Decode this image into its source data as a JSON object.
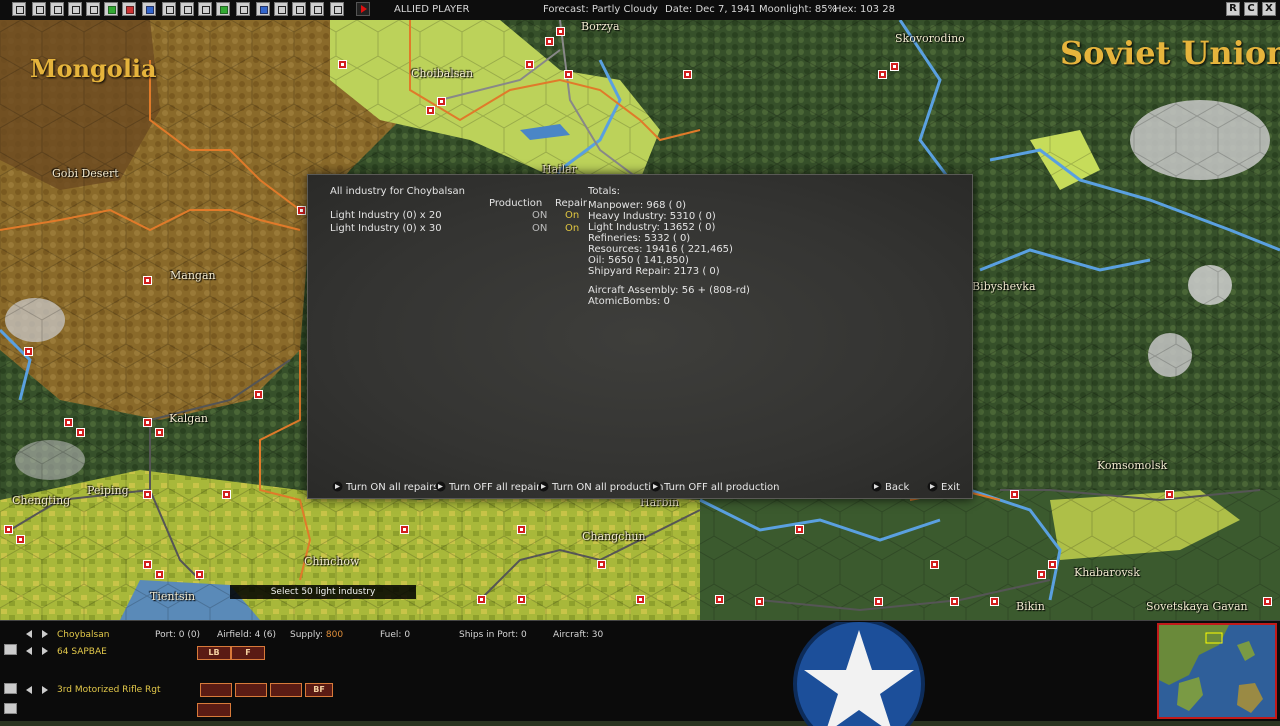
{
  "topbar": {
    "player": "ALLIED PLAYER",
    "forecast": "Forecast: Partly Cloudy",
    "date": "Date: Dec 7, 1941",
    "moonlight": "Moonlight: 85%",
    "hex": "Hex: 103 28",
    "window_buttons": [
      "R",
      "C",
      "X"
    ]
  },
  "map": {
    "countries": [
      "Mongolia",
      "Soviet Union"
    ],
    "places": [
      "Borzya",
      "Skovorodino",
      "Choibalsan",
      "Hailar",
      "Gobi Desert",
      "Mangan",
      "Kalgan",
      "Peiping",
      "Chengting",
      "Chinchow",
      "Tientsin",
      "Harbin",
      "Changchun",
      "Komsomolsk",
      "Khabarovsk",
      "Bikin",
      "Sovetskaya Gavan",
      "Bibyshevka"
    ]
  },
  "dialog": {
    "title": "All industry for Choybalsan",
    "col_production": "Production",
    "col_repair": "Repair",
    "rows": [
      {
        "name": "Light Industry  (0) x 20",
        "production": "ON",
        "repair": "On"
      },
      {
        "name": "Light Industry  (0) x 30",
        "production": "ON",
        "repair": "On"
      }
    ],
    "totals_title": "Totals:",
    "totals": [
      "Manpower: 968  ( 0)",
      "Heavy Industry: 5310  ( 0)",
      "Light Industry: 13652  ( 0)",
      "Refineries: 5332  ( 0)",
      "Resources: 19416  ( 221,465)",
      "Oil: 5650  ( 141,850)",
      "Shipyard Repair: 2173  ( 0)"
    ],
    "aircraft_assembly": "Aircraft Assembly: 56 + (808-rd)",
    "atomic_bombs": "AtomicBombs: 0",
    "buttons": {
      "repairs_on": "Turn ON all repairs",
      "repairs_off": "Turn OFF all repairs",
      "production_on": "Turn ON all production",
      "production_off": "Turn OFF all production",
      "back": "Back",
      "exit": "Exit"
    }
  },
  "tooltip": "Select 50 light industry",
  "bottom": {
    "base_name": "Choybalsan",
    "port": "Port: 0 (0)",
    "airfield": "Airfield: 4 (6)",
    "supply_label": "Supply:",
    "supply_value": "800",
    "fuel": "Fuel: 0",
    "ships_in_port": "Ships in Port: 0",
    "aircraft": "Aircraft: 30",
    "air_unit": "64 SAPBAE",
    "ground_unit": "3rd Motorized Rifle Rgt",
    "air_unit_boxes": [
      "LB",
      "F"
    ],
    "ground_unit_boxes": [
      "BF"
    ]
  },
  "colors": {
    "dialog_bg": "#363634",
    "repair_on": "#e0c640",
    "unit_red": "#d21e1e",
    "country_label": "#e6b43c",
    "supply": "#e08f3a",
    "minimap_frame": "#c21a1a"
  }
}
